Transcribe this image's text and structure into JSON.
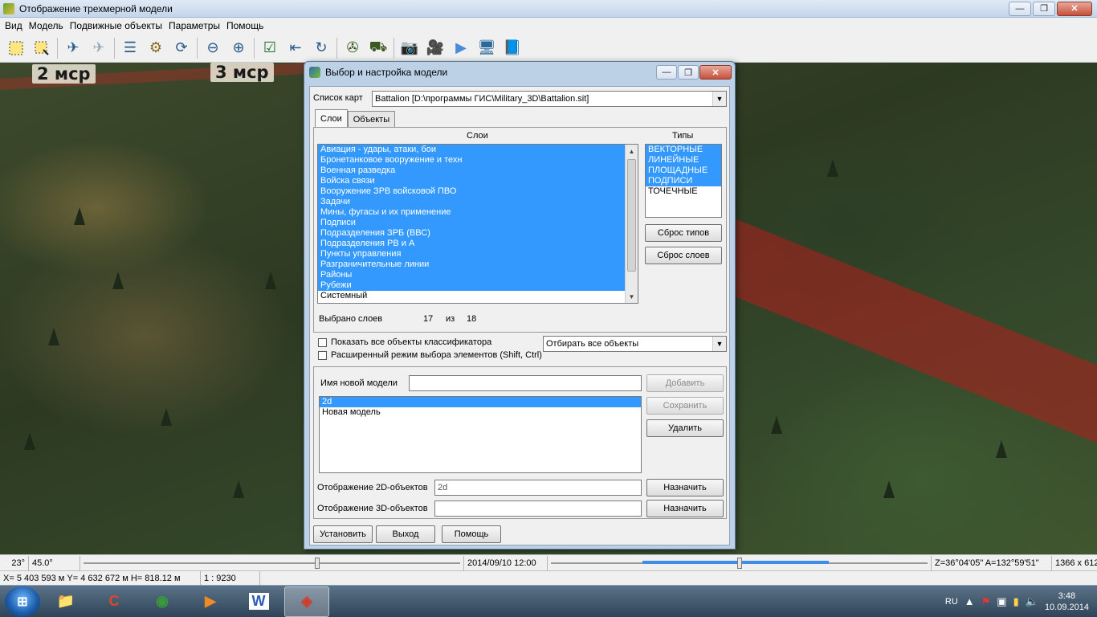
{
  "window": {
    "title": "Отображение трехмерной модели",
    "minimize": "—",
    "restore": "❐",
    "close": "✕"
  },
  "menu": [
    "Вид",
    "Модель",
    "Подвижные объекты",
    "Параметры",
    "Помощь"
  ],
  "toolbar": {
    "icons": [
      "select-rect-icon",
      "select-rect-alt-icon",
      "route-plane-icon",
      "plane-icon",
      "layers-icon",
      "gear-icon",
      "refresh-icon",
      "zoom-out-icon",
      "zoom-in-icon",
      "check-icon",
      "back-arrow-icon",
      "rotate-icon",
      "helicopter-icon",
      "vehicle-icon",
      "camera-icon",
      "video-camera-icon",
      "play-icon",
      "monitor-icon",
      "book-icon"
    ]
  },
  "viewport": {
    "labels": [
      "2 мср",
      "3 мср"
    ]
  },
  "dialog": {
    "title": "Выбор и настройка модели",
    "map_list_label": "Список карт",
    "map_list_value": "Battalion [D:\\программы ГИС\\Military_3D\\Battalion.sit]",
    "tabs": [
      "Слои",
      "Объекты"
    ],
    "layers_header": "Слои",
    "types_header": "Типы",
    "layers": [
      {
        "name": "Авиация - удары, атаки, бои",
        "selected": true
      },
      {
        "name": "Бронетанковое вооружение и техн",
        "selected": true
      },
      {
        "name": "Военная разведка",
        "selected": true
      },
      {
        "name": "Войска связи",
        "selected": true
      },
      {
        "name": "Вооружение ЗРВ войсковой ПВО",
        "selected": true
      },
      {
        "name": "Задачи",
        "selected": true
      },
      {
        "name": "Мины, фугасы и их применение",
        "selected": true
      },
      {
        "name": "Подписи",
        "selected": true
      },
      {
        "name": "Подразделения ЗРБ (ВВС)",
        "selected": true
      },
      {
        "name": "Подразделения РВ и А",
        "selected": true
      },
      {
        "name": "Пункты управления",
        "selected": true
      },
      {
        "name": "Разграничительные линии",
        "selected": true
      },
      {
        "name": "Районы",
        "selected": true
      },
      {
        "name": "Рубежи",
        "selected": true
      },
      {
        "name": "Системный",
        "selected": false
      }
    ],
    "types": [
      {
        "name": "ВЕКТОРНЫЕ",
        "selected": true
      },
      {
        "name": "ЛИНЕЙНЫЕ",
        "selected": true
      },
      {
        "name": "ПЛОЩАДНЫЕ",
        "selected": true
      },
      {
        "name": "ПОДПИСИ",
        "selected": true
      },
      {
        "name": "ТОЧЕЧНЫЕ",
        "selected": false
      }
    ],
    "reset_types": "Сброс типов",
    "reset_layers": "Сброс слоев",
    "selected_label": "Выбрано слоев",
    "selected_count": "17",
    "of_label": "из",
    "total_count": "18",
    "show_all_label": "Показать все объекты классификатора",
    "extended_mode_label": "Расширенный режим выбора элементов (Shift, Ctrl)",
    "filter_value": "Отбирать все объекты",
    "new_model_label": "Имя новой модели",
    "new_model_value": "",
    "add_button": "Добавить",
    "save_button": "Сохранить",
    "delete_button": "Удалить",
    "models": [
      {
        "name": "2d",
        "selected": true
      },
      {
        "name": "Новая модель",
        "selected": false
      }
    ],
    "display2d_label": "Отображение 2D-объектов",
    "display2d_value": "2d",
    "display3d_label": "Отображение 3D-объектов",
    "display3d_value": "",
    "assign_button": "Назначить",
    "install_button": "Установить",
    "exit_button": "Выход",
    "help_button": "Помощь"
  },
  "status": {
    "angle1": "23°",
    "angle2": "45.0°",
    "datetime": "2014/09/10  12:00",
    "orientation": "Z=36°04'05\"  A=132°59'51\"",
    "resolution": "1366 x 612",
    "coords": "X= 5 403 593 м  Y= 4 632 672 м  H= 818.12 м",
    "scale": "1 : 9230"
  },
  "taskbar": {
    "start": "⊞",
    "apps": [
      {
        "name": "explorer",
        "glyph": "📁",
        "color": "#f4c542"
      },
      {
        "name": "ccleaner",
        "glyph": "C",
        "color": "#e0462f"
      },
      {
        "name": "chrome",
        "glyph": "◉",
        "color": "#3a9b3a"
      },
      {
        "name": "media-player",
        "glyph": "▶",
        "color": "#f08a24"
      },
      {
        "name": "word",
        "glyph": "W",
        "color": "#2b5cb5"
      },
      {
        "name": "gis-app",
        "glyph": "◈",
        "color": "#d33c2c"
      }
    ],
    "lang": "RU",
    "time": "3:48",
    "date": "10.09.2014"
  }
}
